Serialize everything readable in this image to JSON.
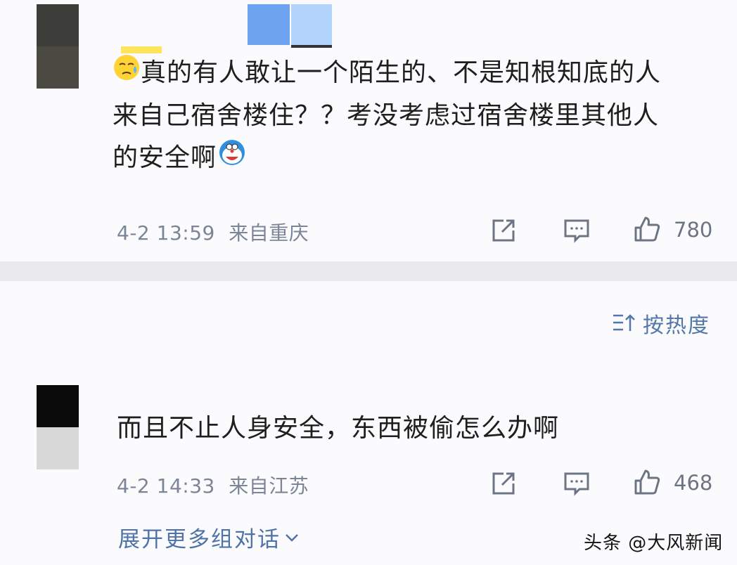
{
  "comments": [
    {
      "text_line1": "真的有人敢让一个陌生的、不是知根知底的人",
      "text_line2": "来自己宿舍楼住？？考没考虑过宿舍楼里其他人",
      "text_line3": "的安全啊",
      "date": "4-2 13:59",
      "location": "来自重庆",
      "likes": "780"
    },
    {
      "text": "而且不止人身安全，东西被偷怎么办啊",
      "date": "4-2 14:33",
      "location": "来自江苏",
      "likes": "468"
    }
  ],
  "sort": {
    "label": "按热度"
  },
  "expand": {
    "label": "展开更多组对话"
  },
  "watermark": "头条 @大风新闻",
  "colors": {
    "link": "#5377a8",
    "meta": "#7c8597",
    "band": "#e9e9ee"
  }
}
